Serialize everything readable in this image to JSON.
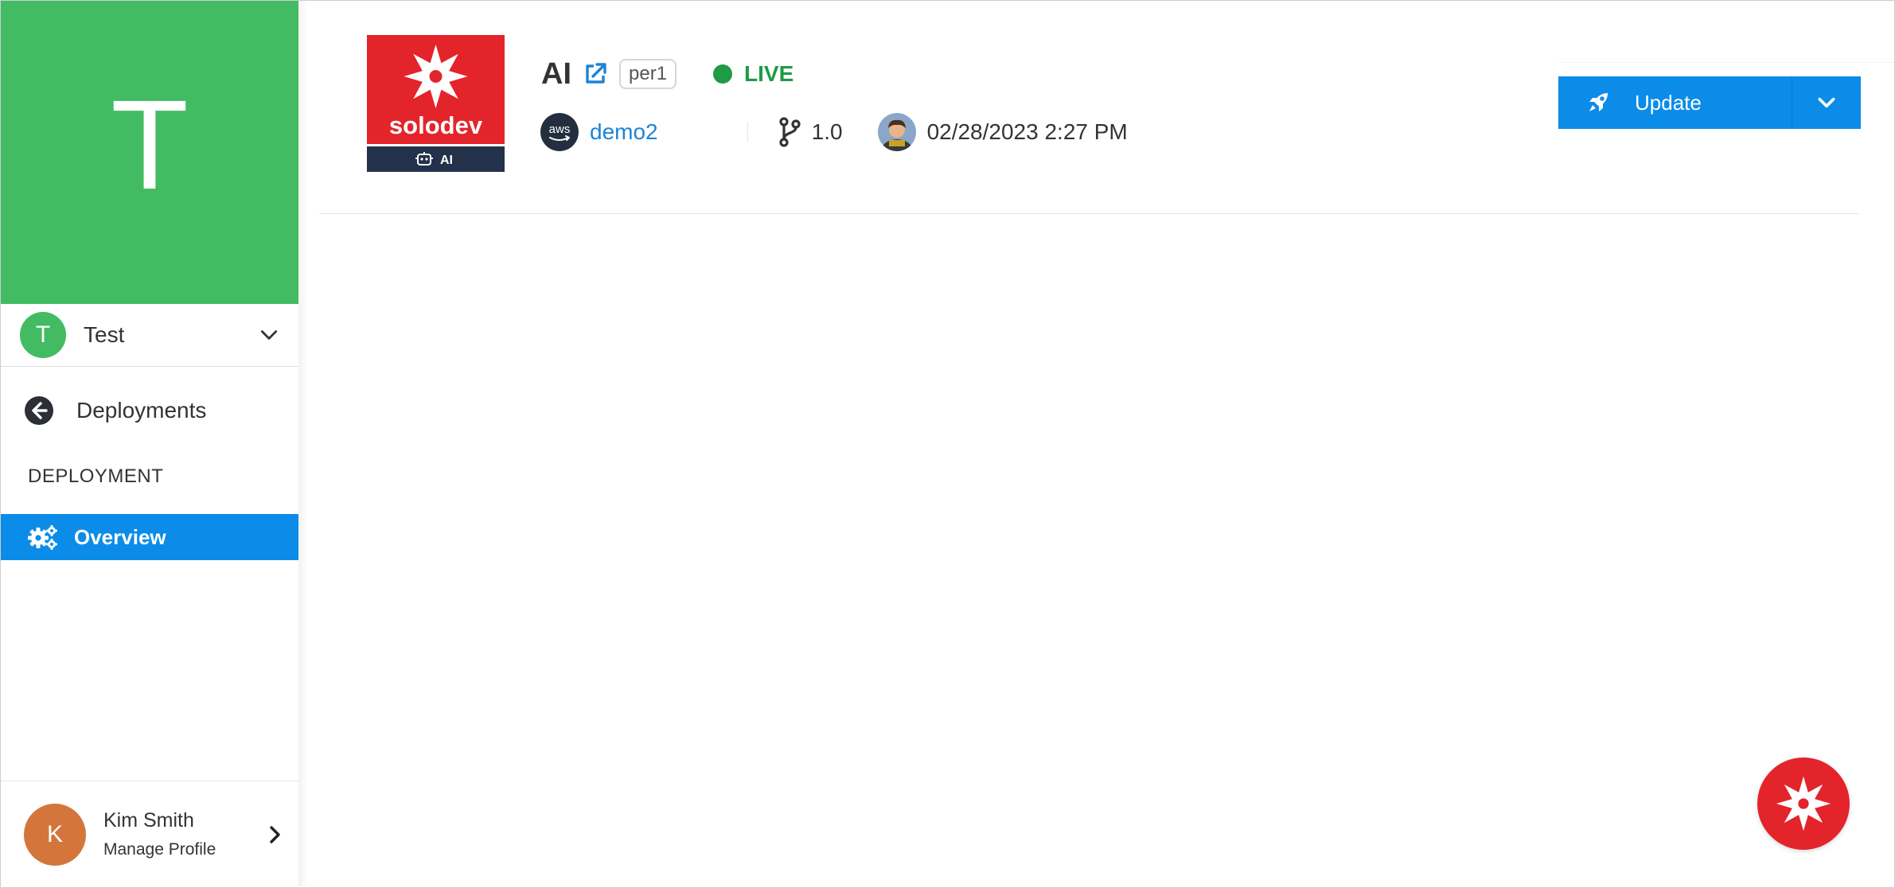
{
  "workspace": {
    "letter": "T",
    "avatar_letter": "T",
    "name": "Test",
    "color": "#42bb62"
  },
  "nav": {
    "back_label": "Deployments",
    "section_label": "DEPLOYMENT",
    "items": [
      {
        "label": "Overview",
        "icon": "gears-icon",
        "active": true
      }
    ],
    "active_color": "#0c8ce9"
  },
  "profile": {
    "avatar_letter": "K",
    "name": "Kim Smith",
    "subtitle": "Manage Profile",
    "avatar_color": "#d4763c"
  },
  "deployment": {
    "logo": {
      "brand": "solodev",
      "badge": "AI",
      "color": "#e3242b"
    },
    "title": "AI",
    "tag": "per1",
    "status": "LIVE",
    "status_color": "#1f9a45",
    "provider_icon": "aws-icon",
    "provider_label": "aws",
    "environment": "demo2",
    "version": "1.0",
    "updated_at": "02/28/2023 2:27 PM"
  },
  "actions": {
    "update_label": "Update"
  }
}
